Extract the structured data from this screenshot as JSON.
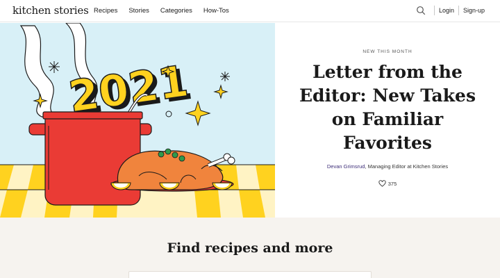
{
  "header": {
    "logo": "kitchen stories",
    "nav": [
      "Recipes",
      "Stories",
      "Categories",
      "How-Tos"
    ],
    "login": "Login",
    "signup": "Sign-up"
  },
  "hero": {
    "illustration_year": "2021",
    "kicker": "NEW THIS MONTH",
    "headline": "Letter from the Editor: New Takes on Familiar Favorites",
    "author": "Devan Grimsrud",
    "author_role": ", Managing Editor at Kitchen Stories",
    "likes": "375"
  },
  "find": {
    "title": "Find recipes and more"
  },
  "colors": {
    "accent_author": "#3d2d78",
    "illustration_sky": "#d8f0f7",
    "illustration_yellow": "#ffd21f",
    "illustration_red": "#ea3b35",
    "find_bg": "#f6f3ef"
  }
}
